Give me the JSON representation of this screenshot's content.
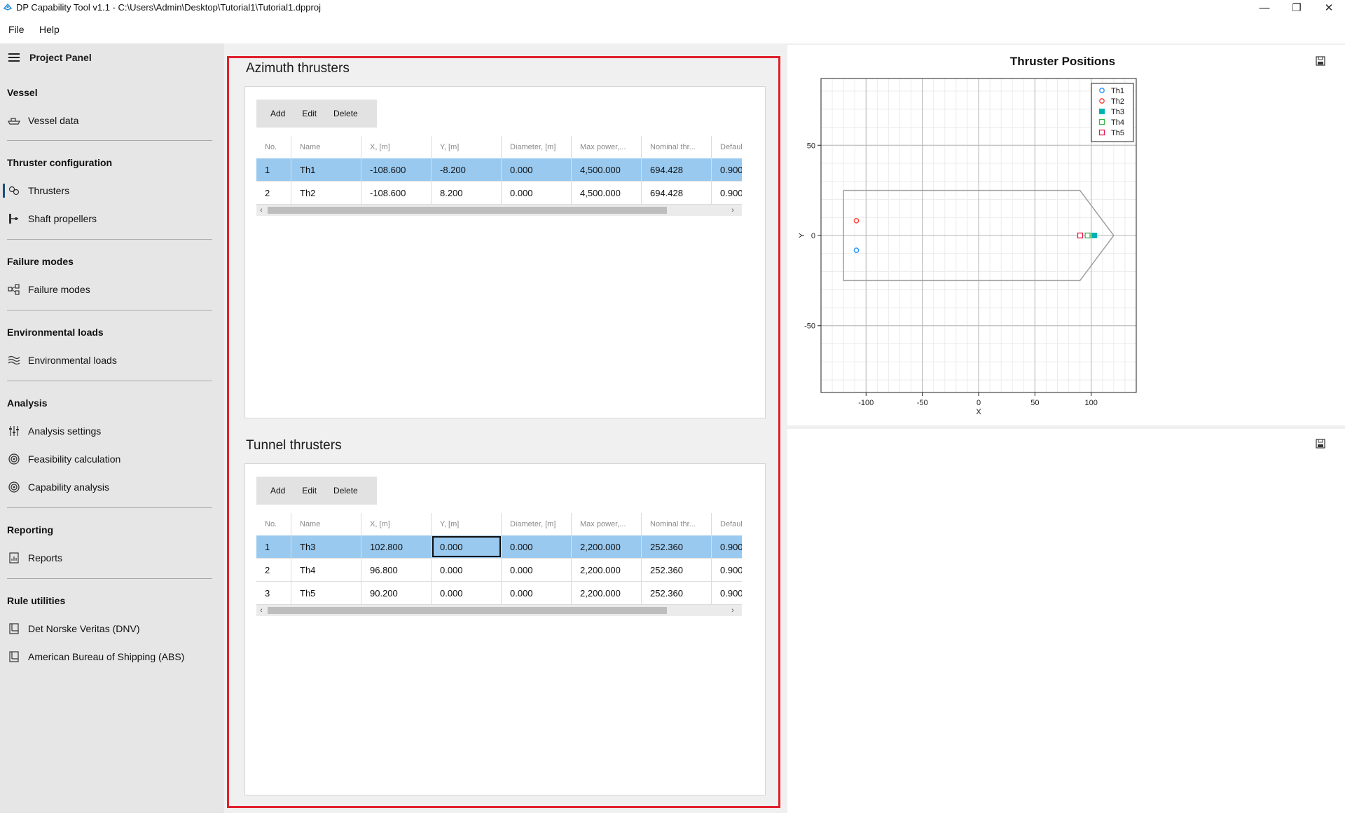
{
  "window": {
    "title": "DP Capability Tool v1.1 - C:\\Users\\Admin\\Desktop\\Tutorial1\\Tutorial1.dpproj",
    "minimize": "—",
    "maximize": "❐",
    "close": "✕"
  },
  "menu": {
    "file": "File",
    "help": "Help"
  },
  "sidebar": {
    "header": "Project Panel",
    "sections": [
      {
        "title": "Vessel",
        "items": [
          {
            "label": "Vessel data",
            "icon": "vessel-icon"
          }
        ]
      },
      {
        "title": "Thruster configuration",
        "items": [
          {
            "label": "Thrusters",
            "icon": "thrusters-icon",
            "active": true
          },
          {
            "label": "Shaft propellers",
            "icon": "propeller-icon"
          }
        ]
      },
      {
        "title": "Failure modes",
        "items": [
          {
            "label": "Failure modes",
            "icon": "failure-modes-icon"
          }
        ]
      },
      {
        "title": "Environmental loads",
        "items": [
          {
            "label": "Environmental loads",
            "icon": "waves-icon"
          }
        ]
      },
      {
        "title": "Analysis",
        "items": [
          {
            "label": "Analysis settings",
            "icon": "sliders-icon"
          },
          {
            "label": "Feasibility calculation",
            "icon": "target-icon"
          },
          {
            "label": "Capability analysis",
            "icon": "target-icon"
          }
        ]
      },
      {
        "title": "Reporting",
        "items": [
          {
            "label": "Reports",
            "icon": "report-icon"
          }
        ]
      },
      {
        "title": "Rule utilities",
        "items": [
          {
            "label": "Det Norske Veritas (DNV)",
            "icon": "book-icon"
          },
          {
            "label": "American Bureau of Shipping (ABS)",
            "icon": "book-icon"
          }
        ]
      }
    ]
  },
  "toolbar": {
    "add": "Add",
    "edit": "Edit",
    "delete": "Delete"
  },
  "columns": [
    "No.",
    "Name",
    "X, [m]",
    "Y, [m]",
    "Diameter, [m]",
    "Max power,...",
    "Nominal thr...",
    "Default th"
  ],
  "azimuth": {
    "title": "Azimuth thrusters",
    "rows": [
      [
        "1",
        "Th1",
        "-108.600",
        "-8.200",
        "0.000",
        "4,500.000",
        "694.428",
        "0.900"
      ],
      [
        "2",
        "Th2",
        "-108.600",
        "8.200",
        "0.000",
        "4,500.000",
        "694.428",
        "0.900"
      ]
    ]
  },
  "tunnel": {
    "title": "Tunnel thrusters",
    "rows": [
      [
        "1",
        "Th3",
        "102.800",
        "0.000",
        "0.000",
        "2,200.000",
        "252.360",
        "0.900"
      ],
      [
        "2",
        "Th4",
        "96.800",
        "0.000",
        "0.000",
        "2,200.000",
        "252.360",
        "0.900"
      ],
      [
        "3",
        "Th5",
        "90.200",
        "0.000",
        "0.000",
        "2,200.000",
        "252.360",
        "0.900"
      ]
    ]
  },
  "chart_data": {
    "type": "scatter",
    "title": "Thruster Positions",
    "xlabel": "X",
    "ylabel": "Y",
    "xlim": [
      -140,
      140
    ],
    "ylim": [
      -87,
      87
    ],
    "xticks": [
      -100,
      -50,
      0,
      50,
      100
    ],
    "yticks": [
      -50,
      0,
      50
    ],
    "grid": true,
    "legend_position": "top-right",
    "series": [
      {
        "name": "Th1",
        "x": [
          -108.6
        ],
        "y": [
          -8.2
        ],
        "color": "#1f8fff",
        "marker": "circle"
      },
      {
        "name": "Th2",
        "x": [
          -108.6
        ],
        "y": [
          8.2
        ],
        "color": "#ff3b30",
        "marker": "circle"
      },
      {
        "name": "Th3",
        "x": [
          102.8
        ],
        "y": [
          0.0
        ],
        "color": "#00b3b3",
        "marker": "square-filled"
      },
      {
        "name": "Th4",
        "x": [
          96.8
        ],
        "y": [
          0.0
        ],
        "color": "#3cb44b",
        "marker": "square"
      },
      {
        "name": "Th5",
        "x": [
          90.2
        ],
        "y": [
          0.0
        ],
        "color": "#e6194b",
        "marker": "square"
      }
    ],
    "hull_outline": {
      "x": [
        -120,
        90,
        120,
        90,
        -120,
        -120
      ],
      "y": [
        25,
        25,
        0,
        -25,
        -25,
        25
      ],
      "color": "#a0a0a0"
    }
  }
}
